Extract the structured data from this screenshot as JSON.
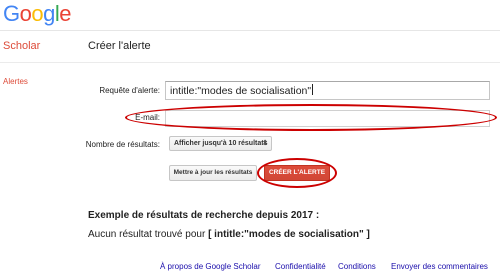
{
  "header": {
    "logo_letters": [
      {
        "ch": "G",
        "color": "#4285F4"
      },
      {
        "ch": "o",
        "color": "#EA4335"
      },
      {
        "ch": "o",
        "color": "#FBBC05"
      },
      {
        "ch": "g",
        "color": "#4285F4"
      },
      {
        "ch": "l",
        "color": "#34A853"
      },
      {
        "ch": "e",
        "color": "#EA4335"
      }
    ],
    "product": "Scholar",
    "page_title": "Créer l'alerte"
  },
  "sidebar": {
    "alertes_label": "Alertes"
  },
  "form": {
    "query_label": "Requête d'alerte:",
    "query_value": "intitle:\"modes de socialisation\"",
    "email_label": "E-mail:",
    "email_value": "",
    "results_label": "Nombre de résultats:",
    "results_selected": "Afficher jusqu'à 10 résultats",
    "results_arrow": "⬍",
    "update_button": "Mettre à jour les résultats",
    "create_button": "CRÉER L'ALERTE"
  },
  "preview": {
    "title": "Exemple de résultats de recherche depuis 2017 :",
    "no_result_prefix": "Aucun résultat trouvé pour ",
    "no_result_query": "[ intitle:\"modes de socialisation\" ]"
  },
  "footer": {
    "about": "À propos de Google Scholar",
    "privacy": "Confidentialité",
    "terms": "Conditions",
    "feedback": "Envoyer des commentaires"
  },
  "colors": {
    "accent_red": "#dd4b39",
    "highlight_oval": "#cc0000",
    "link": "#1a0dab"
  }
}
